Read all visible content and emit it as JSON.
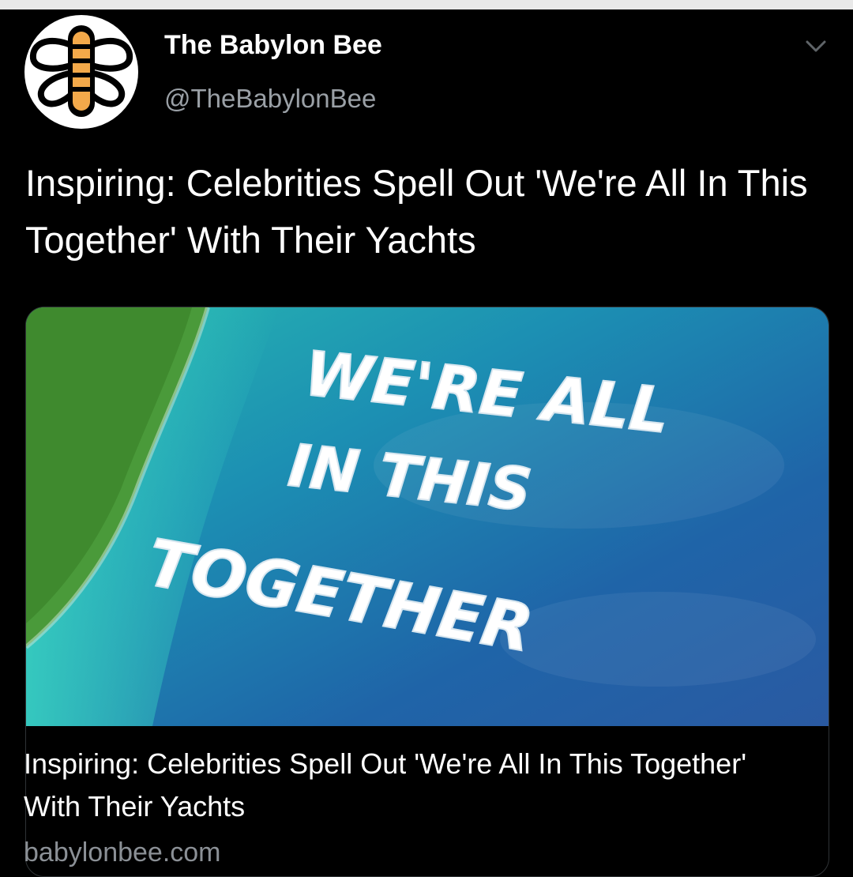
{
  "tweet": {
    "display_name": "The Babylon Bee",
    "handle": "@TheBabylonBee",
    "text": "Inspiring: Celebrities Spell Out 'We're All In This Together' With Their Yachts",
    "menu_icon": "chevron-down-icon",
    "avatar_icon": "bee-logo-icon"
  },
  "link_card": {
    "title": "Inspiring: Celebrities Spell Out 'We're All In This Together' With Their Yachts",
    "domain": "babylonbee.com",
    "image": {
      "lines": [
        "WE'RE ALL",
        "IN THIS",
        "TOGETHER"
      ]
    }
  },
  "colors": {
    "background": "#000000",
    "text_primary": "#ffffff",
    "text_secondary": "#9aa0a6",
    "card_border": "#2f3336",
    "bee_yellow": "#f3a94a"
  }
}
